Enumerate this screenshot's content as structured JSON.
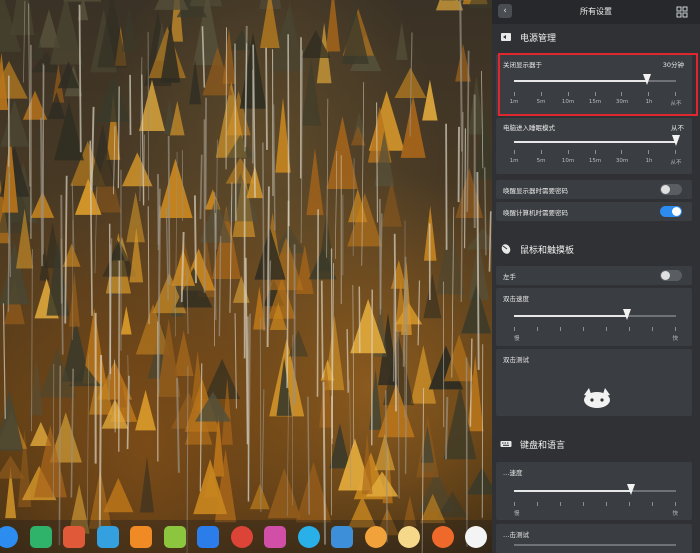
{
  "window": {
    "title": "所有设置",
    "back_glyph": "‹"
  },
  "power": {
    "section_title": "电源管理",
    "display_off": {
      "label": "关闭显示器于",
      "value": "30分钟",
      "position": 0.82,
      "ticks": [
        "1m",
        "5m",
        "10m",
        "15m",
        "30m",
        "1h",
        "从不"
      ]
    },
    "sleep": {
      "label": "电脑进入睡眠模式",
      "value": "从不",
      "position": 1.0,
      "ticks": [
        "1m",
        "5m",
        "10m",
        "15m",
        "30m",
        "1h",
        "从不"
      ]
    },
    "wake_display_password": {
      "label": "唤醒显示器时需要密码",
      "on": false
    },
    "wake_computer_password": {
      "label": "唤醒计算机时需要密码",
      "on": true
    }
  },
  "mouse": {
    "section_title": "鼠标和触摸板",
    "left_hand": {
      "label": "左手",
      "on": false
    },
    "double_click_speed": {
      "label": "双击速度",
      "position": 0.7,
      "min_label": "慢",
      "max_label": "快"
    },
    "double_click_test": {
      "label": "双击测试"
    }
  },
  "keyboard": {
    "section_title": "键盘和语言",
    "repeat_speed": {
      "label": "…速度",
      "position": 0.72,
      "min_label": "慢",
      "max_label": "快"
    },
    "test_label": "…击测试"
  },
  "colors": {
    "accent": "#2d8cf0",
    "panel_bg": "#2f3134",
    "card_bg": "#3a3d41",
    "highlight": "#e0262e"
  },
  "dock_items": [
    {
      "name": "launcher-icon",
      "color": "#2d8cf0"
    },
    {
      "name": "terminal-icon",
      "color": "#2fb36b"
    },
    {
      "name": "store-icon",
      "color": "#e05a3a"
    },
    {
      "name": "files-icon",
      "color": "#34a0e0"
    },
    {
      "name": "calendar-icon",
      "color": "#f08a24"
    },
    {
      "name": "music-icon",
      "color": "#8cc63f"
    },
    {
      "name": "video-icon",
      "color": "#2b7de9"
    },
    {
      "name": "chrome-icon",
      "color": "#db4437"
    },
    {
      "name": "settings-icon",
      "color": "#d24fa8"
    },
    {
      "name": "assistant-icon",
      "color": "#2ab0e8"
    },
    {
      "name": "mail-icon",
      "color": "#3c8fd8"
    },
    {
      "name": "power-icon",
      "color": "#f2a23a"
    },
    {
      "name": "messenger-icon",
      "color": "#f5d88a"
    },
    {
      "name": "eject-icon",
      "color": "#ef6a2a"
    },
    {
      "name": "flag-icon",
      "color": "#f4f4f4"
    }
  ]
}
